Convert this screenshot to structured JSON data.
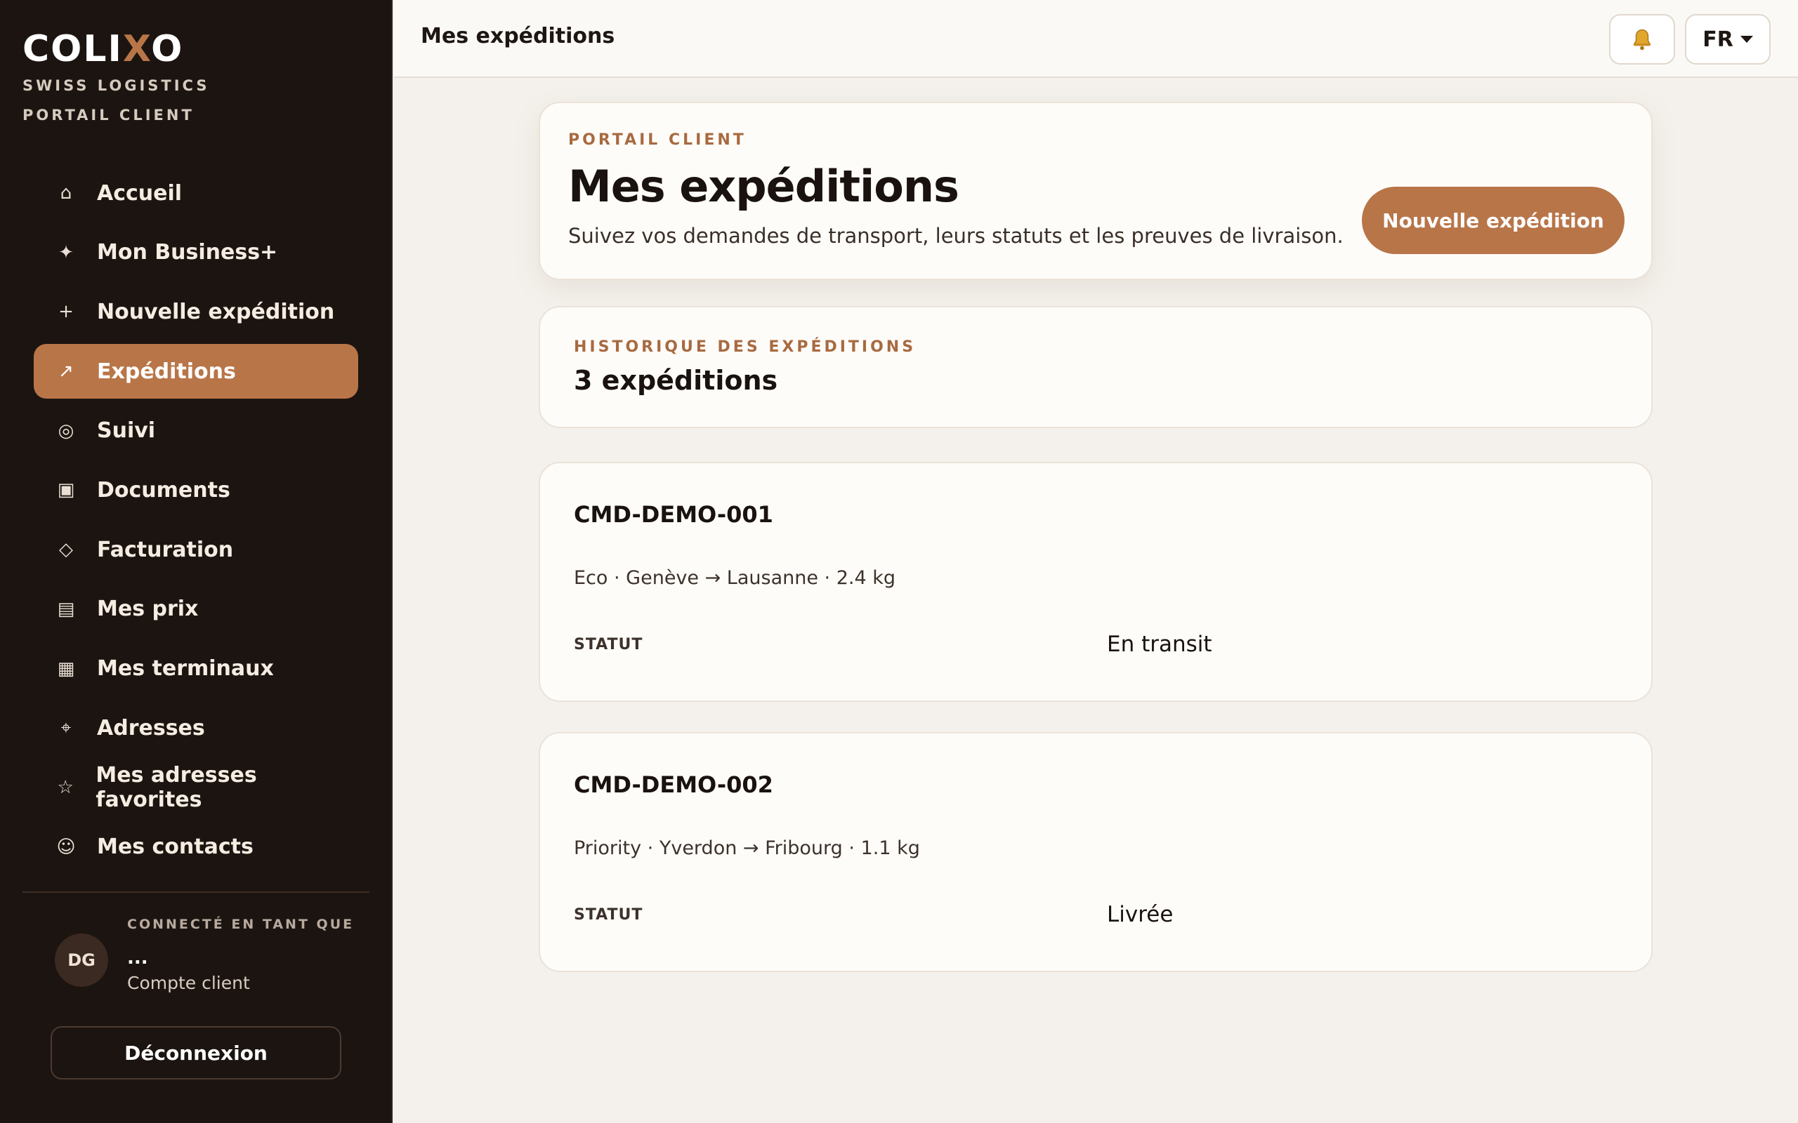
{
  "brand": {
    "name_prefix": "COLI",
    "name_accent": "X",
    "name_suffix": "O",
    "tagline": "SWISS LOGISTICS",
    "subtitle": "PORTAIL CLIENT"
  },
  "sidebar": {
    "items": [
      {
        "label": "Accueil",
        "icon": "⌂",
        "icon_name": "home-icon"
      },
      {
        "label": "Mon Business+",
        "icon": "✦",
        "icon_name": "sparkle-icon"
      },
      {
        "label": "Nouvelle expédition",
        "icon": "+",
        "icon_name": "plus-icon"
      },
      {
        "label": "Expéditions",
        "icon": "↗",
        "icon_name": "arrow-up-right-icon",
        "active": true
      },
      {
        "label": "Suivi",
        "icon": "◎",
        "icon_name": "target-icon"
      },
      {
        "label": "Documents",
        "icon": "▣",
        "icon_name": "document-icon"
      },
      {
        "label": "Facturation",
        "icon": "◇",
        "icon_name": "diamond-icon"
      },
      {
        "label": "Mes prix",
        "icon": "▤",
        "icon_name": "price-list-icon"
      },
      {
        "label": "Mes terminaux",
        "icon": "▦",
        "icon_name": "grid-icon"
      },
      {
        "label": "Adresses",
        "icon": "⌖",
        "icon_name": "crosshair-icon"
      },
      {
        "label": "Mes adresses favorites",
        "icon": "☆",
        "icon_name": "star-icon"
      },
      {
        "label": "Mes contacts",
        "icon": "☺",
        "icon_name": "smiley-icon"
      }
    ],
    "user": {
      "caption": "CONNECTÉ EN TANT QUE",
      "initials": "DG",
      "name": "...",
      "role": "Compte client"
    },
    "logout_label": "Déconnexion"
  },
  "topbar": {
    "title": "Mes expéditions",
    "bell_icon": "bell-icon",
    "language": "FR"
  },
  "hero": {
    "eyebrow": "PORTAIL CLIENT",
    "title": "Mes expéditions",
    "description": "Suivez vos demandes de transport, leurs statuts et les preuves de livraison.",
    "cta_label": "Nouvelle expédition"
  },
  "history": {
    "eyebrow": "HISTORIQUE DES EXPÉDITIONS",
    "count_label": "3 expéditions"
  },
  "shipments": [
    {
      "ref": "CMD-DEMO-001",
      "meta": "Eco · Genève → Lausanne · 2.4 kg",
      "status_label": "STATUT",
      "status_value": "En transit"
    },
    {
      "ref": "CMD-DEMO-002",
      "meta": "Priority · Yverdon → Fribourg · 1.1 kg",
      "status_label": "STATUT",
      "status_value": "Livrée"
    }
  ],
  "colors": {
    "accent": "#b87548",
    "sidebar_bg": "#1c1410",
    "page_bg": "#f4f1ec",
    "card_bg": "#fefcf9"
  }
}
